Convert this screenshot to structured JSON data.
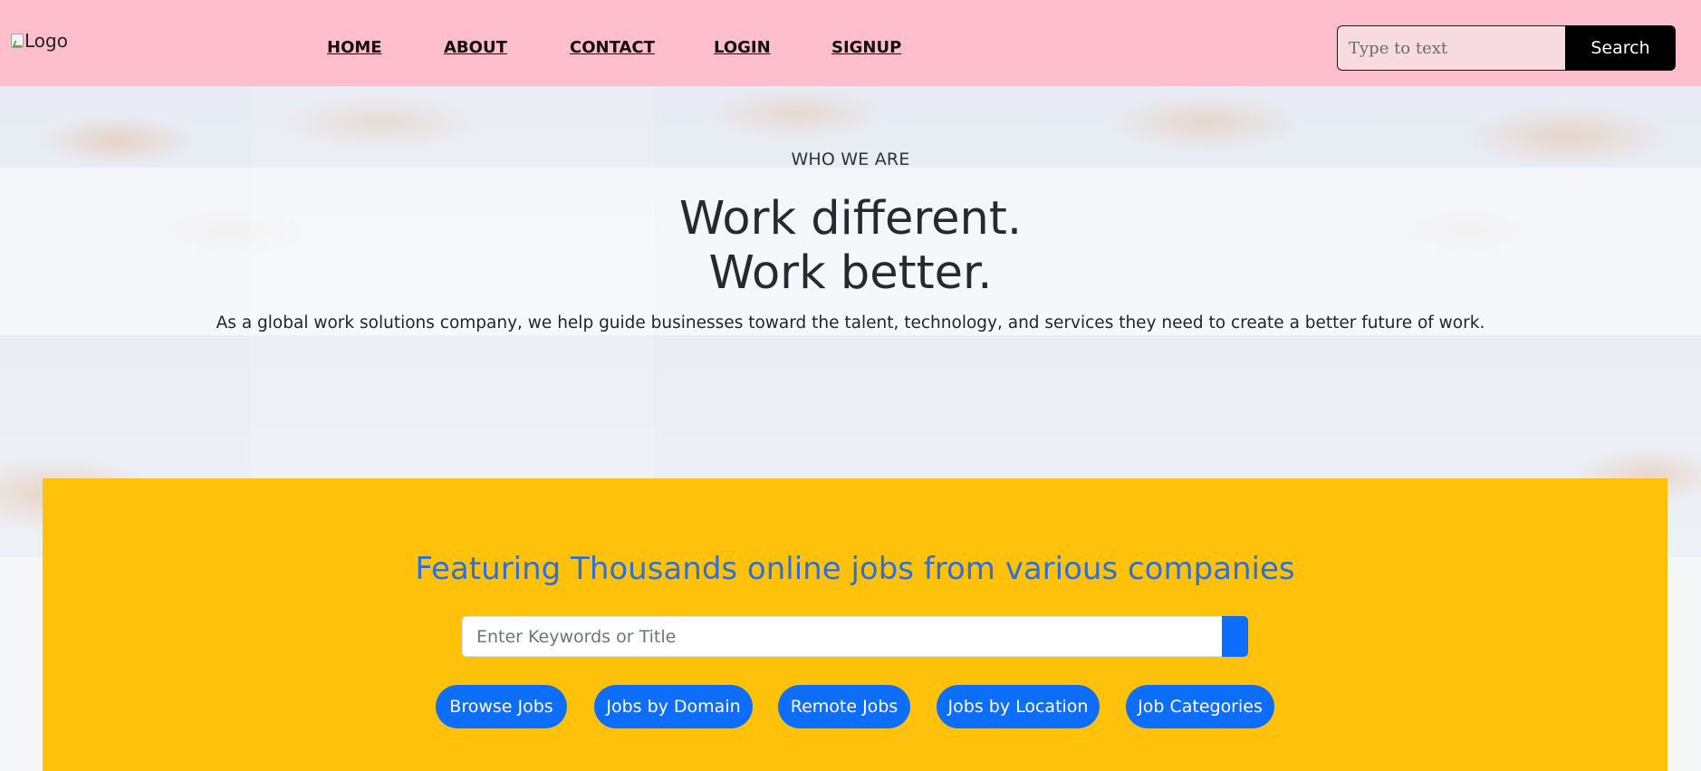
{
  "header": {
    "logo_alt": "Logo",
    "nav": [
      "HOME",
      "ABOUT",
      "CONTACT",
      "LOGIN",
      "SIGNUP"
    ],
    "search": {
      "placeholder": "Type to text",
      "button_label": "Search"
    }
  },
  "hero": {
    "eyebrow": "WHO WE ARE",
    "title_line1": "Work different.",
    "title_line2": "Work better.",
    "description": "As a global work solutions company, we help guide businesses toward the talent, technology, and services they need to create a better future of work."
  },
  "jobs": {
    "title": "Featuring Thousands online jobs from various companies",
    "search_placeholder": "Enter Keywords or Title",
    "buttons": [
      "Browse Jobs",
      "Jobs by Domain",
      "Remote Jobs",
      "Jobs by Location",
      "Job Categories"
    ]
  },
  "colors": {
    "header_bg": "#ffbecb",
    "panel_bg": "#ffc10a",
    "accent": "#0d6efd",
    "jobs_title": "#2e6fd8"
  }
}
